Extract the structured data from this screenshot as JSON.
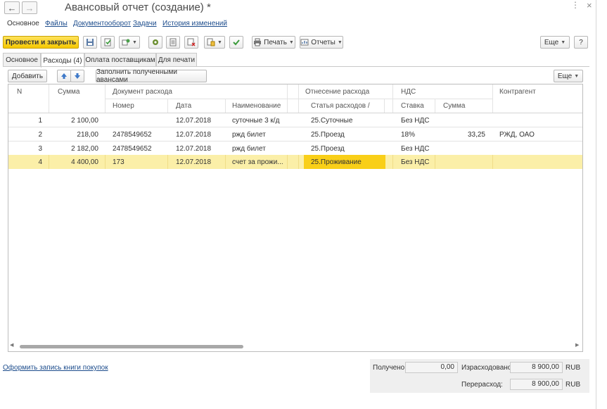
{
  "window": {
    "title": "Авансовый отчет (создание) *",
    "back_icon": "←",
    "forward_icon": "→",
    "more_icon": "⋮",
    "close_icon": "×"
  },
  "panes": [
    "Основное",
    "Файлы",
    "Документооборот",
    "Задачи",
    "История изменений"
  ],
  "toolbar": {
    "post_close_label": "Провести и закрыть",
    "print_label": "Печать",
    "reports_label": "Отчеты",
    "more_label": "Еще",
    "help_label": "?"
  },
  "tabs": [
    "Основное",
    "Расходы (4)",
    "Оплата поставщикам",
    "Для печати"
  ],
  "table_toolbar": {
    "add_label": "Добавить",
    "fill_label": "Заполнить полученными авансами",
    "more_label": "Еще"
  },
  "table": {
    "headers": {
      "n": "N",
      "sum": "Сумма",
      "doc": "Документ расхода",
      "doc_number": "Номер",
      "doc_date": "Дата",
      "doc_name": "Наименование",
      "allocation": "Отнесение расхода",
      "article": "Статья расходов /",
      "vat": "НДС",
      "vat_rate": "Ставка",
      "vat_sum": "Сумма",
      "counterparty": "Контрагент"
    },
    "rows": [
      {
        "n": "1",
        "sum": "2 100,00",
        "number": "",
        "date": "12.07.2018",
        "name": "суточные 3 к/д",
        "article": "25.Суточные",
        "rate": "Без НДС",
        "vat_sum": "",
        "counterparty": ""
      },
      {
        "n": "2",
        "sum": "218,00",
        "number": "2478549652",
        "date": "12.07.2018",
        "name": "ржд билет",
        "article": "25.Проезд",
        "rate": "18%",
        "vat_sum": "33,25",
        "counterparty": "РЖД, ОАО"
      },
      {
        "n": "3",
        "sum": "2 182,00",
        "number": "2478549652",
        "date": "12.07.2018",
        "name": "ржд билет",
        "article": "25.Проезд",
        "rate": "Без НДС",
        "vat_sum": "",
        "counterparty": ""
      },
      {
        "n": "4",
        "sum": "4 400,00",
        "number": "173",
        "date": "12.07.2018",
        "name": "счет за прожи...",
        "article": "25.Проживание",
        "rate": "Без НДС",
        "vat_sum": "",
        "counterparty": ""
      }
    ],
    "selected_row": 3
  },
  "footer": {
    "link_label": "Оформить запись книги покупок",
    "received_label": "Получено:",
    "received_value": "0,00",
    "spent_label": "Израсходовано:",
    "spent_value": "8 900,00",
    "spent_currency": "RUB",
    "overspent_label": "Перерасход:",
    "overspent_value": "8 900,00",
    "overspent_currency": "RUB"
  },
  "colors": {
    "primary_button": "#f5c800",
    "selected_row": "#fbefa8",
    "selected_cell": "#f9cf18",
    "link": "#1c4c8c"
  }
}
